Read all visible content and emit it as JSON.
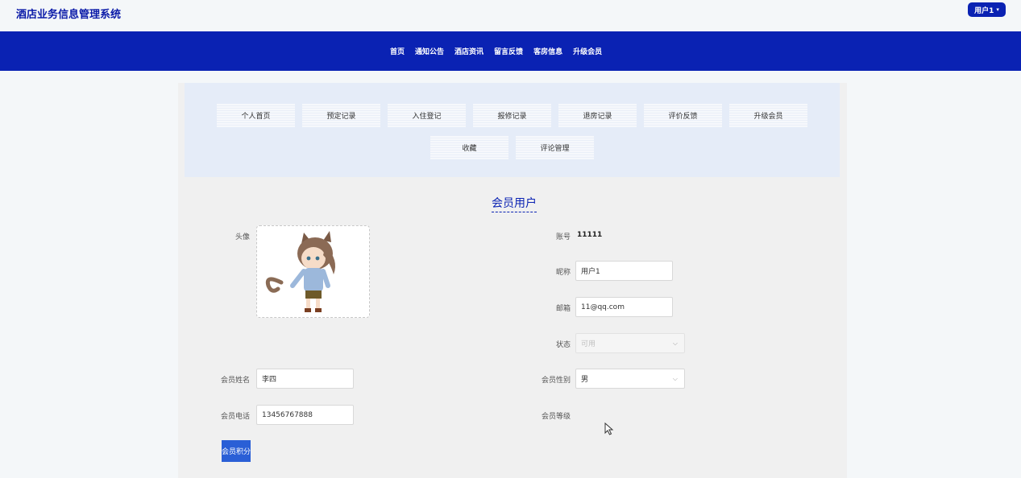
{
  "app": {
    "title": "酒店业务信息管理系统"
  },
  "user_menu": {
    "label": "用户1"
  },
  "nav": {
    "items": [
      "首页",
      "通知公告",
      "酒店资讯",
      "留言反馈",
      "客房信息",
      "升级会员"
    ]
  },
  "center_menu": {
    "items": [
      "个人首页",
      "预定记录",
      "入住登记",
      "报修记录",
      "退房记录",
      "评价反馈",
      "升级会员",
      "收藏",
      "评论管理"
    ]
  },
  "form": {
    "title": "会员用户",
    "avatar_label": "头像",
    "account_label": "账号",
    "account_value": "11111",
    "nickname_label": "昵称",
    "nickname_value": "用户1",
    "email_label": "邮箱",
    "email_value": "11@qq.com",
    "status_label": "状态",
    "status_value": "可用",
    "name_label": "会员姓名",
    "name_value": "李四",
    "gender_label": "会员性别",
    "gender_value": "男",
    "phone_label": "会员电话",
    "phone_value": "13456767888",
    "level_label": "会员等级",
    "score_button": "会员积分"
  }
}
